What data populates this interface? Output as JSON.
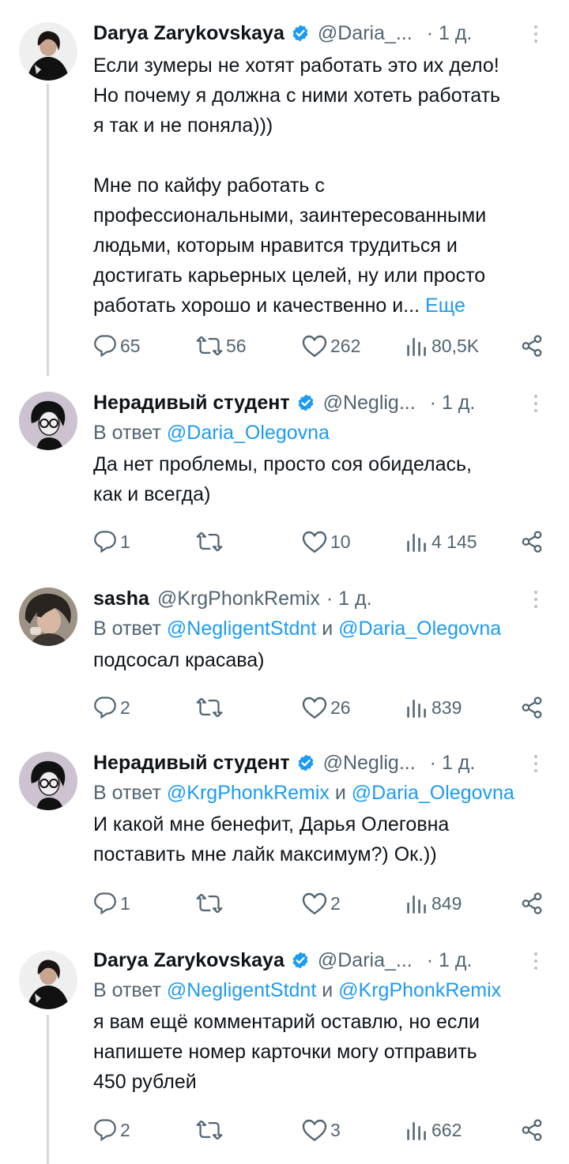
{
  "tweets": [
    {
      "name": "Darya Zarykovskaya",
      "handle": "@Daria_...",
      "time": "· 1 д.",
      "verified": true,
      "reply_prefix": "",
      "reply_to": "",
      "reply_and": "",
      "reply_to2": "",
      "text": "Если зумеры не хотят работать это их дело!\nНо почему я должна с ними хотеть работать\nя так и не поняла)))\n\nМне по кайфу работать с\nпрофессиональными, заинтересованными\nлюдьми, которым нравится трудиться и\nдостигать карьерных целей, ну или просто\nработать хорошо и качественно и... ",
      "more_link": "Еще",
      "replies": "65",
      "retweets": "56",
      "likes": "262",
      "views": "80,5K"
    },
    {
      "name": "Нерадивый студент",
      "handle": "@Neglig...",
      "time": "· 1 д.",
      "verified": true,
      "reply_prefix": "В ответ ",
      "reply_to": "@Daria_Olegovna",
      "reply_and": "",
      "reply_to2": "",
      "text": "Да нет проблемы, просто соя обиделась,\nкак и всегда)",
      "more_link": "",
      "replies": "1",
      "retweets": "",
      "likes": "10",
      "views": "4 145"
    },
    {
      "name": "sasha",
      "handle": "@KrgPhonkRemix",
      "time": "· 1 д.",
      "verified": false,
      "reply_prefix": "В ответ ",
      "reply_to": "@NegligentStdnt",
      "reply_and": " и ",
      "reply_to2": "@Daria_Olegovna",
      "text": "подсосал красава)",
      "more_link": "",
      "replies": "2",
      "retweets": "",
      "likes": "26",
      "views": "839"
    },
    {
      "name": "Нерадивый студент",
      "handle": "@Neglig...",
      "time": "· 1 д.",
      "verified": true,
      "reply_prefix": "В ответ ",
      "reply_to": "@KrgPhonkRemix",
      "reply_and": " и ",
      "reply_to2": "@Daria_Olegovna",
      "text": "И какой мне бенефит, Дарья Олеговна\nпоставить мне лайк максимум?) Ок.))",
      "more_link": "",
      "replies": "1",
      "retweets": "",
      "likes": "2",
      "views": "849"
    },
    {
      "name": "Darya Zarykovskaya",
      "handle": "@Daria_...",
      "time": "· 1 д.",
      "verified": true,
      "reply_prefix": "В ответ ",
      "reply_to": "@NegligentStdnt",
      "reply_and": " и ",
      "reply_to2": "@KrgPhonkRemix",
      "text": "я вам ещё комментарий оставлю, но если\nнапишете номер карточки могу отправить\n450 рублей",
      "more_link": "",
      "replies": "2",
      "retweets": "",
      "likes": "3",
      "views": "662"
    }
  ],
  "colors": {
    "text": "#0f1419",
    "secondary": "#536471",
    "link": "#1d9bf0",
    "verified": "#1d9bf0",
    "thread_line": "#cfd9de"
  }
}
